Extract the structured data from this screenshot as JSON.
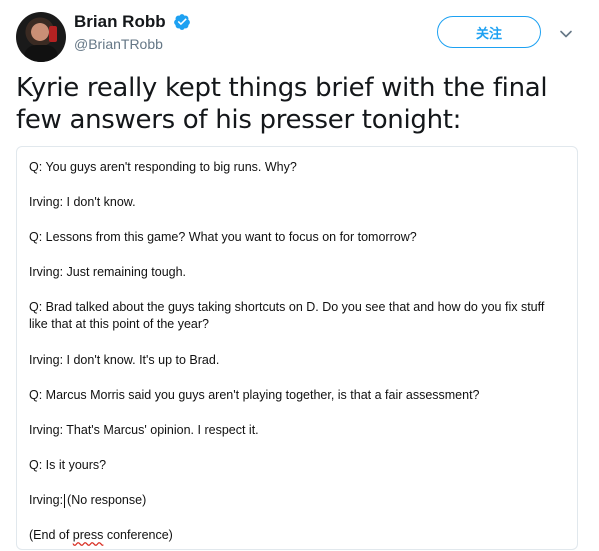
{
  "author": {
    "display_name": "Brian Robb",
    "handle": "@BrianTRobb",
    "verified": true,
    "avatar_icon": "avatar-photo"
  },
  "follow_button": {
    "label": "关注"
  },
  "tweet": {
    "text": "Kyrie really kept things brief with the final few answers of his presser tonight:"
  },
  "transcript": {
    "lines": [
      "Q: You guys aren't responding to big runs. Why?",
      "Irving: I don't know.",
      "Q: Lessons from this game? What you want to focus on for tomorrow?",
      "Irving: Just remaining tough.",
      "Q: Brad talked about the guys taking shortcuts on D. Do you see that and how do you fix stuff like that at this point of the year?",
      "Irving: I don't know. It's up to Brad.",
      "Q: Marcus Morris said you guys aren't playing together, is that a fair assessment?",
      "Irving: That's Marcus' opinion. I respect it.",
      "Q: Is it yours?"
    ],
    "no_response_prefix": "Irving:",
    "no_response_text": "(No response)",
    "end_open": "(End of ",
    "end_word": "press",
    "end_close": " conference)"
  },
  "colors": {
    "brand_blue": "#1da1f2",
    "text_primary": "#14171a",
    "text_secondary": "#657786",
    "border": "#e1e8ed"
  }
}
